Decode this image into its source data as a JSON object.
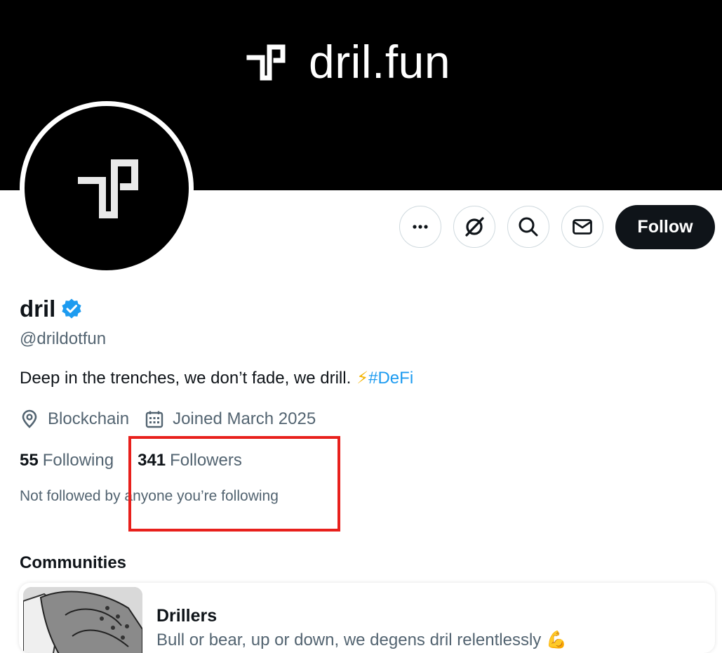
{
  "banner": {
    "title": "dril.fun"
  },
  "actions": {
    "more_icon": "more-horizontal-icon",
    "grok_icon": "grok-icon",
    "search_icon": "search-icon",
    "message_icon": "envelope-icon",
    "follow_label": "Follow"
  },
  "profile": {
    "display_name": "dril",
    "handle": "@drildotfun",
    "bio_text": "Deep in the trenches, we don’t fade, we drill.",
    "bio_emoji": "⚡",
    "bio_hashtag": "#DeFi",
    "location": "Blockchain",
    "joined": "Joined March 2025",
    "following_count": "55",
    "following_label": "Following",
    "followers_count": "341",
    "followers_label": "Followers",
    "not_followed": "Not followed by anyone you’re following"
  },
  "communities": {
    "title": "Communities",
    "items": [
      {
        "name": "Drillers",
        "description": "Bull or bear, up or down, we degens dril relentlessly 💪"
      }
    ]
  },
  "colors": {
    "accent": "#1d9bf0",
    "text_primary": "#0f1419",
    "text_secondary": "#536471",
    "highlight": "#e8201c"
  }
}
